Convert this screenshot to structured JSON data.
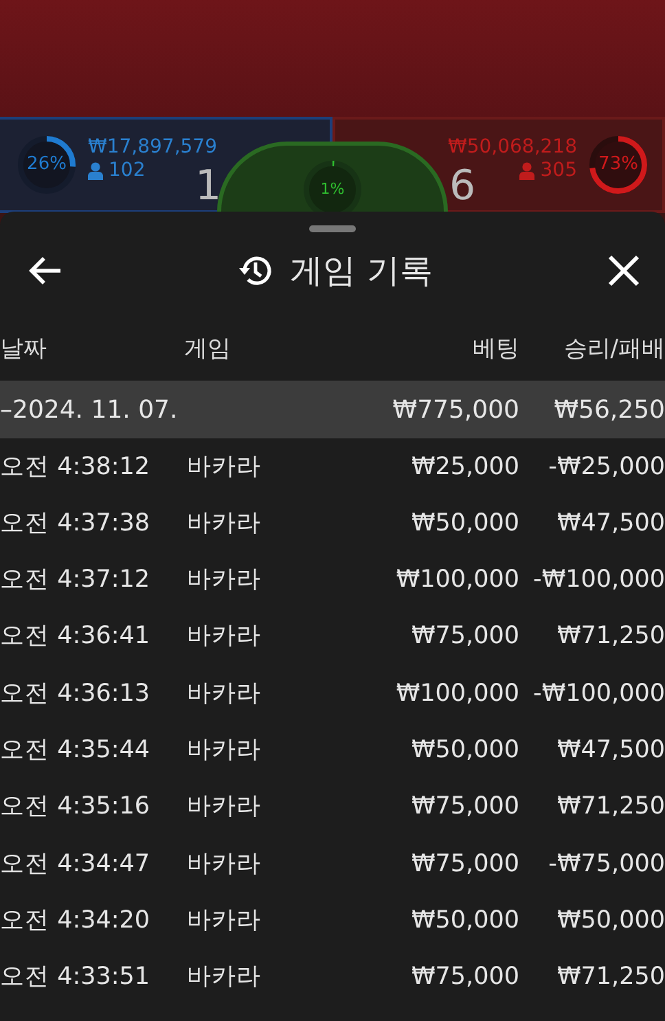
{
  "scoreboard": {
    "player": {
      "percent": "26%",
      "level": 0.26,
      "amount": "₩17,897,579",
      "players": "102",
      "score": "1"
    },
    "tie": {
      "percent": "1%",
      "level": 0.01
    },
    "banker": {
      "percent": "73%",
      "level": 0.73,
      "amount": "₩50,068,218",
      "players": "305",
      "score": "6"
    }
  },
  "sheet": {
    "title": "게임 기록",
    "columns": [
      "날짜",
      "게임",
      "베팅",
      "승리/패배"
    ],
    "summary": {
      "date": "–2024. 11. 07.",
      "bet": "₩775,000",
      "result": "₩56,250"
    },
    "rows": [
      {
        "time": "오전 4:38:12",
        "game": "바카라",
        "bet": "₩25,000",
        "result": "-₩25,000"
      },
      {
        "time": "오전 4:37:38",
        "game": "바카라",
        "bet": "₩50,000",
        "result": "₩47,500"
      },
      {
        "time": "오전 4:37:12",
        "game": "바카라",
        "bet": "₩100,000",
        "result": "-₩100,000"
      },
      {
        "time": "오전 4:36:41",
        "game": "바카라",
        "bet": "₩75,000",
        "result": "₩71,250"
      },
      {
        "time": "오전 4:36:13",
        "game": "바카라",
        "bet": "₩100,000",
        "result": "-₩100,000"
      },
      {
        "time": "오전 4:35:44",
        "game": "바카라",
        "bet": "₩50,000",
        "result": "₩47,500"
      },
      {
        "time": "오전 4:35:16",
        "game": "바카라",
        "bet": "₩75,000",
        "result": "₩71,250"
      },
      {
        "time": "오전 4:34:47",
        "game": "바카라",
        "bet": "₩75,000",
        "result": "-₩75,000"
      },
      {
        "time": "오전 4:34:20",
        "game": "바카라",
        "bet": "₩50,000",
        "result": "₩50,000"
      },
      {
        "time": "오전 4:33:51",
        "game": "바카라",
        "bet": "₩75,000",
        "result": "₩71,250"
      }
    ]
  }
}
